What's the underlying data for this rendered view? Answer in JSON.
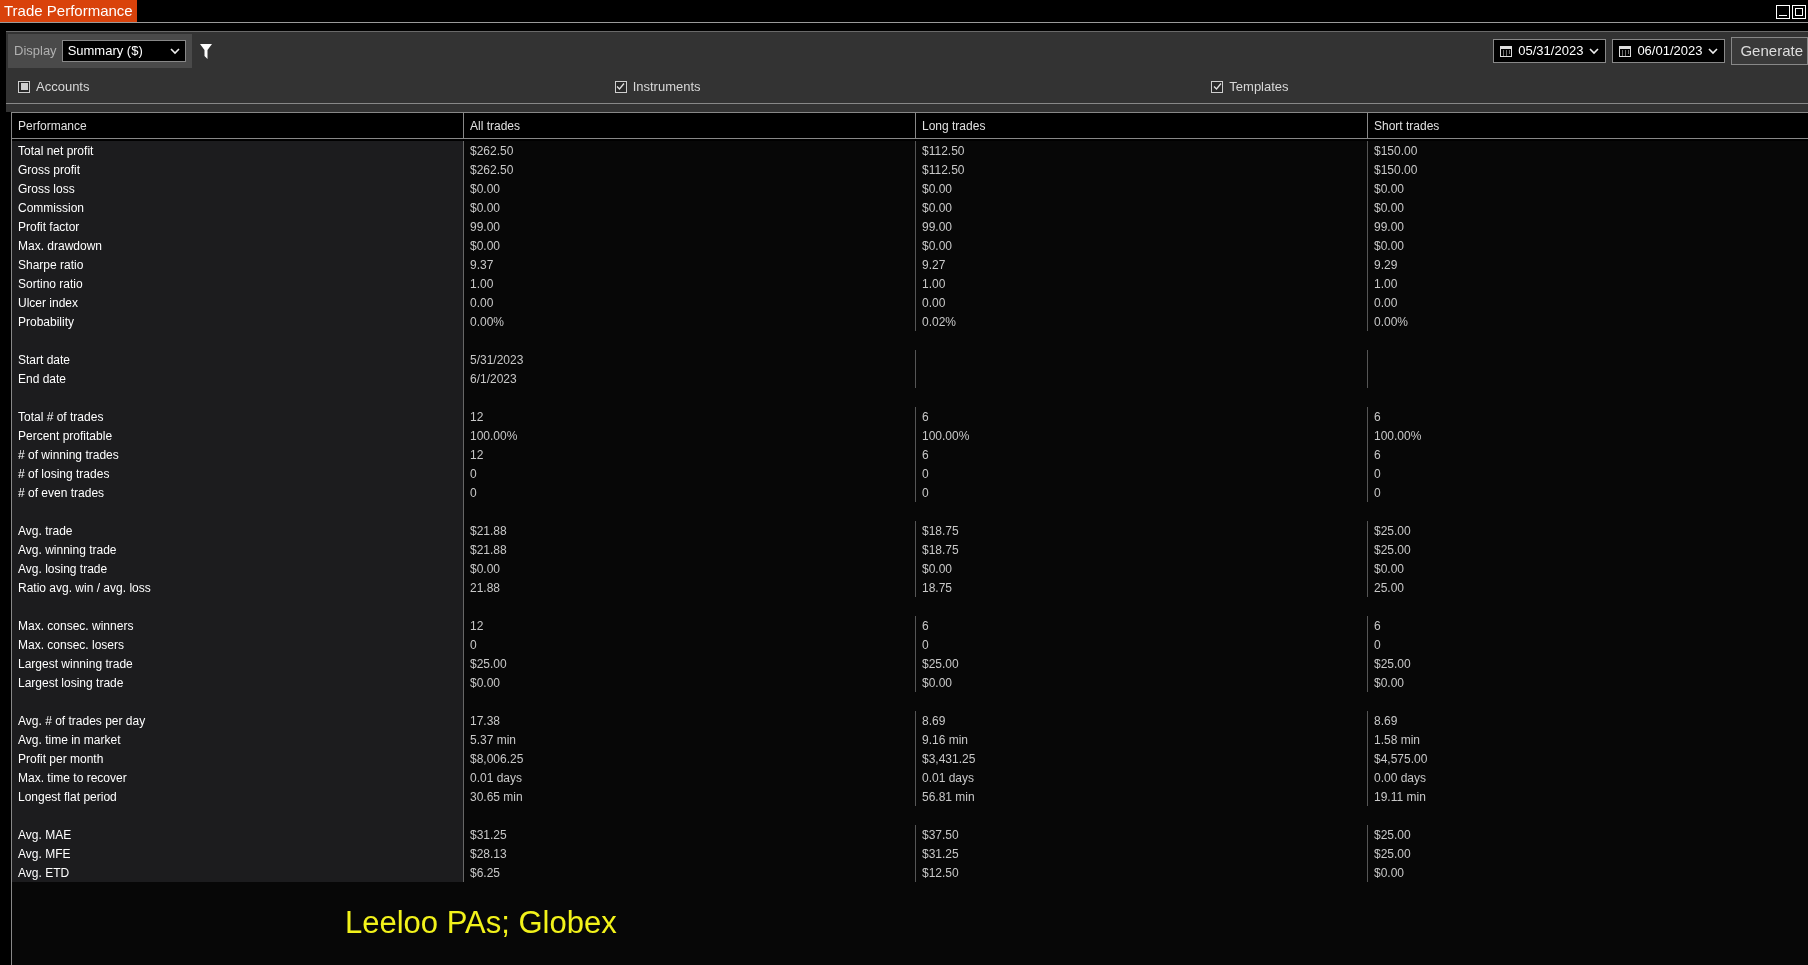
{
  "window": {
    "title": "Trade Performance"
  },
  "toolbar": {
    "display_label": "Display",
    "display_value": "Summary ($)",
    "start_date": "05/31/2023",
    "end_date": "06/01/2023",
    "generate_button": "Generate"
  },
  "filters": [
    {
      "label": "Accounts",
      "checked": true,
      "mixed": true
    },
    {
      "label": "Instruments",
      "checked": true,
      "mixed": false
    },
    {
      "label": "Templates",
      "checked": true,
      "mixed": false
    }
  ],
  "table": {
    "columns": [
      "Performance",
      "All trades",
      "Long trades",
      "Short trades"
    ],
    "sections": [
      [
        {
          "cells": [
            "Total net profit",
            "$262.50",
            "$112.50",
            "$150.00"
          ]
        },
        {
          "cells": [
            "Gross profit",
            "$262.50",
            "$112.50",
            "$150.00"
          ]
        },
        {
          "cells": [
            "Gross loss",
            "$0.00",
            "$0.00",
            "$0.00"
          ]
        },
        {
          "cells": [
            "Commission",
            "$0.00",
            "$0.00",
            "$0.00"
          ]
        },
        {
          "cells": [
            "Profit factor",
            "99.00",
            "99.00",
            "99.00"
          ]
        },
        {
          "cells": [
            "Max. drawdown",
            "$0.00",
            "$0.00",
            "$0.00"
          ]
        },
        {
          "cells": [
            "Sharpe ratio",
            "9.37",
            "9.27",
            "9.29"
          ]
        },
        {
          "cells": [
            "Sortino ratio",
            "1.00",
            "1.00",
            "1.00"
          ]
        },
        {
          "cells": [
            "Ulcer index",
            "0.00",
            "0.00",
            "0.00"
          ]
        },
        {
          "cells": [
            "Probability",
            "0.00%",
            "0.02%",
            "0.00%"
          ]
        }
      ],
      [
        {
          "cells": [
            "Start date",
            "5/31/2023"
          ]
        },
        {
          "cells": [
            "End date",
            "6/1/2023"
          ]
        }
      ],
      [
        {
          "cells": [
            "Total # of trades",
            "12",
            "6",
            "6"
          ]
        },
        {
          "cells": [
            "Percent profitable",
            "100.00%",
            "100.00%",
            "100.00%"
          ]
        },
        {
          "cells": [
            "# of winning trades",
            "12",
            "6",
            "6"
          ]
        },
        {
          "cells": [
            "# of losing trades",
            "0",
            "0",
            "0"
          ]
        },
        {
          "cells": [
            "# of even trades",
            "0",
            "0",
            "0"
          ]
        }
      ],
      [
        {
          "cells": [
            "Avg. trade",
            "$21.88",
            "$18.75",
            "$25.00"
          ]
        },
        {
          "cells": [
            "Avg. winning trade",
            "$21.88",
            "$18.75",
            "$25.00"
          ]
        },
        {
          "cells": [
            "Avg. losing trade",
            "$0.00",
            "$0.00",
            "$0.00"
          ]
        },
        {
          "cells": [
            "Ratio avg. win / avg. loss",
            "21.88",
            "18.75",
            "25.00"
          ]
        }
      ],
      [
        {
          "cells": [
            "Max. consec. winners",
            "12",
            "6",
            "6"
          ]
        },
        {
          "cells": [
            "Max. consec. losers",
            "0",
            "0",
            "0"
          ]
        },
        {
          "cells": [
            "Largest winning trade",
            "$25.00",
            "$25.00",
            "$25.00"
          ]
        },
        {
          "cells": [
            "Largest losing trade",
            "$0.00",
            "$0.00",
            "$0.00"
          ]
        }
      ],
      [
        {
          "cells": [
            "Avg. # of trades per day",
            "17.38",
            "8.69",
            "8.69"
          ]
        },
        {
          "cells": [
            "Avg. time in market",
            "5.37 min",
            "9.16 min",
            "1.58 min"
          ]
        },
        {
          "cells": [
            "Profit per month",
            "$8,006.25",
            "$3,431.25",
            "$4,575.00"
          ]
        },
        {
          "cells": [
            "Max. time to recover",
            "0.01 days",
            "0.01 days",
            "0.00 days"
          ]
        },
        {
          "cells": [
            "Longest flat period",
            "30.65 min",
            "56.81 min",
            "19.11 min"
          ]
        }
      ],
      [
        {
          "cells": [
            "Avg. MAE",
            "$31.25",
            "$37.50",
            "$25.00"
          ]
        },
        {
          "cells": [
            "Avg. MFE",
            "$28.13",
            "$31.25",
            "$25.00"
          ]
        },
        {
          "cells": [
            "Avg. ETD",
            "$6.25",
            "$12.50",
            "$0.00"
          ]
        }
      ]
    ]
  },
  "overlay_text": "Leeloo PAs; Globex"
}
